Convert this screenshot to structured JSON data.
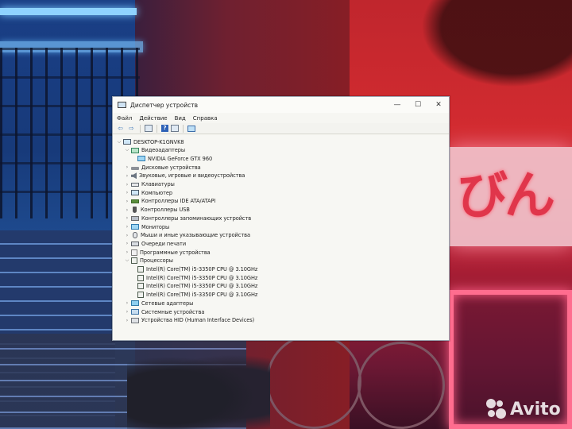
{
  "window": {
    "title": "Диспетчер устройств",
    "controls": {
      "minimize": "—",
      "maximize": "☐",
      "close": "✕"
    }
  },
  "menu": [
    "Файл",
    "Действие",
    "Вид",
    "Справка"
  ],
  "toolbar": [
    {
      "name": "back-icon",
      "glyph": "⇦"
    },
    {
      "name": "forward-icon",
      "glyph": "⇨"
    },
    {
      "name": "properties-icon",
      "glyph": ""
    },
    {
      "name": "help-icon",
      "glyph": "?"
    },
    {
      "name": "view-icon",
      "glyph": ""
    },
    {
      "name": "monitor-icon",
      "glyph": ""
    }
  ],
  "tree": {
    "root": "DESKTOP-K1GNVK8",
    "nodes": [
      {
        "label": "Видеоадаптеры",
        "icon": "gpu-icon",
        "expanded": true,
        "level": 1
      },
      {
        "label": "NVIDIA GeForce GTX 960",
        "icon": "monitor-icon",
        "level": 2
      },
      {
        "label": "Дисковые устройства",
        "icon": "disk-icon",
        "expanded": false,
        "level": 1
      },
      {
        "label": "Звуковые, игровые и видеоустройства",
        "icon": "sound-icon",
        "expanded": false,
        "level": 1
      },
      {
        "label": "Клавиатуры",
        "icon": "keyboard-icon",
        "expanded": false,
        "level": 1
      },
      {
        "label": "Компьютер",
        "icon": "computer-icon",
        "expanded": false,
        "level": 1
      },
      {
        "label": "Контроллеры IDE ATA/ATAPI",
        "icon": "ide-icon",
        "expanded": false,
        "level": 1
      },
      {
        "label": "Контроллеры USB",
        "icon": "usb-icon",
        "expanded": false,
        "level": 1
      },
      {
        "label": "Контроллеры запоминающих устройств",
        "icon": "storage-icon",
        "expanded": false,
        "level": 1
      },
      {
        "label": "Мониторы",
        "icon": "monitor-icon",
        "expanded": false,
        "level": 1
      },
      {
        "label": "Мыши и иные указывающие устройства",
        "icon": "mouse-icon",
        "expanded": false,
        "level": 1
      },
      {
        "label": "Очереди печати",
        "icon": "printer-icon",
        "expanded": false,
        "level": 1
      },
      {
        "label": "Программные устройства",
        "icon": "software-icon",
        "expanded": false,
        "level": 1
      },
      {
        "label": "Процессоры",
        "icon": "cpu-icon",
        "expanded": true,
        "level": 1
      },
      {
        "label": "Intel(R) Core(TM) i5-3350P CPU @ 3.10GHz",
        "icon": "cpu-icon",
        "level": 2
      },
      {
        "label": "Intel(R) Core(TM) i5-3350P CPU @ 3.10GHz",
        "icon": "cpu-icon",
        "level": 2
      },
      {
        "label": "Intel(R) Core(TM) i5-3350P CPU @ 3.10GHz",
        "icon": "cpu-icon",
        "level": 2
      },
      {
        "label": "Intel(R) Core(TM) i5-3350P CPU @ 3.10GHz",
        "icon": "cpu-icon",
        "level": 2
      },
      {
        "label": "Сетевые адаптеры",
        "icon": "network-icon",
        "expanded": false,
        "level": 1
      },
      {
        "label": "Системные устройства",
        "icon": "system-icon",
        "expanded": false,
        "level": 1
      },
      {
        "label": "Устройства HID (Human Interface Devices)",
        "icon": "hid-icon",
        "expanded": false,
        "level": 1
      }
    ]
  },
  "background": {
    "lantern_text": "びん",
    "watermark": "Avito"
  }
}
